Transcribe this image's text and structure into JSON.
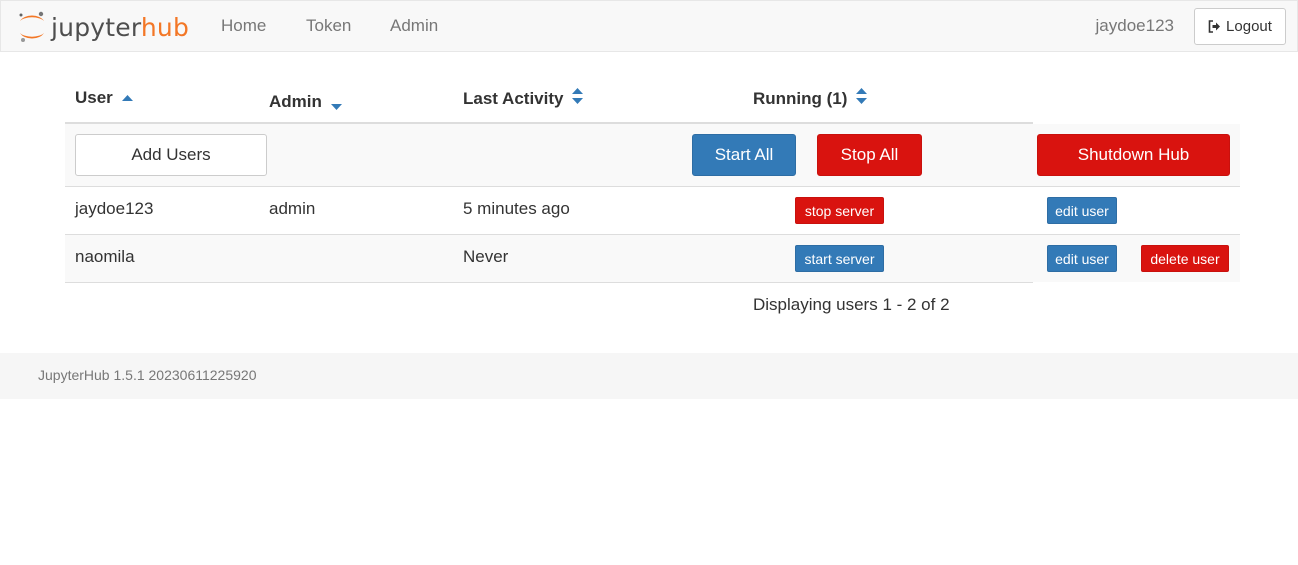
{
  "brand": {
    "name_part1": "jupyter",
    "name_part2": "hub"
  },
  "nav": {
    "links": [
      {
        "label": "Home"
      },
      {
        "label": "Token"
      },
      {
        "label": "Admin"
      }
    ],
    "username": "jaydoe123",
    "logout_label": "Logout"
  },
  "table": {
    "columns": [
      {
        "label": "User",
        "sort": "ascending"
      },
      {
        "label": "Admin",
        "sort": "descending"
      },
      {
        "label": "Last Activity",
        "sort": "unsorted"
      },
      {
        "label": "Running (1)",
        "sort": "unsorted"
      }
    ],
    "actions": {
      "add_users": "Add Users",
      "start_all": "Start All",
      "stop_all": "Stop All",
      "shutdown_hub": "Shutdown Hub"
    },
    "rows": [
      {
        "user": "jaydoe123",
        "admin": "admin",
        "last_activity": "5 minutes ago",
        "server_action": "stop server",
        "edit": "edit user",
        "delete": ""
      },
      {
        "user": "naomila",
        "admin": "",
        "last_activity": "Never",
        "server_action": "start server",
        "edit": "edit user",
        "delete": "delete user"
      }
    ],
    "pagination": "Displaying users 1 - 2 of 2"
  },
  "footer": {
    "version": "JupyterHub 1.5.1 20230611225920"
  },
  "colors": {
    "brand_orange": "#f37726",
    "primary": "#337ab7",
    "danger": "#d9130f"
  },
  "icons": {
    "logo": "jupyter-logo-icon",
    "logout": "sign-out-icon",
    "sort_asc": "sort-up-icon",
    "sort_desc": "sort-down-icon",
    "sort_none": "sort-both-icon"
  }
}
